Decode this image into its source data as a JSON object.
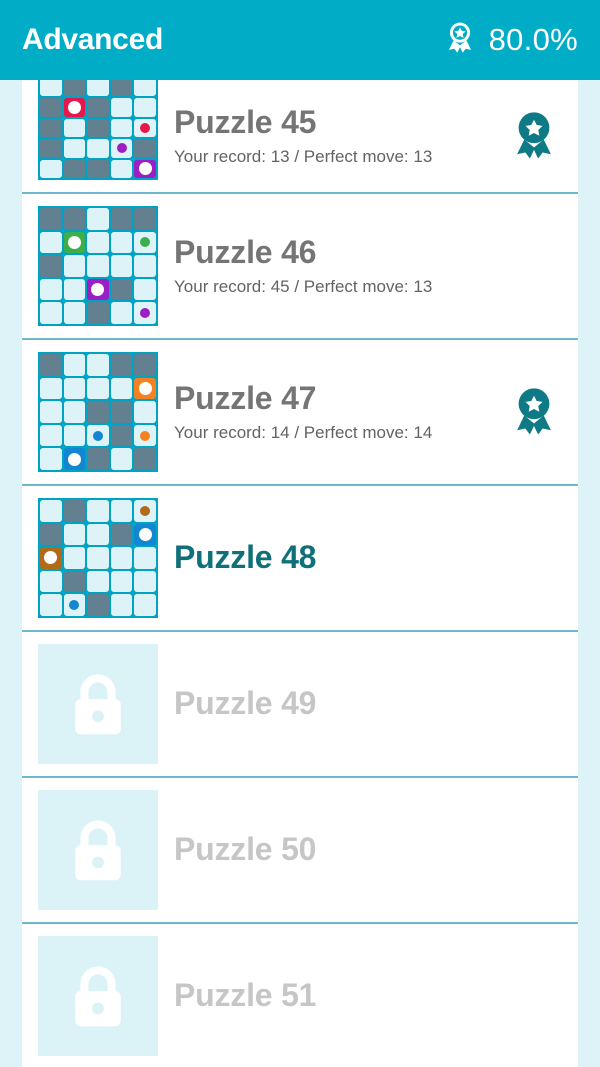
{
  "header": {
    "title": "Advanced",
    "percent": "80.0%",
    "medal_icon": "medal-ribbon-icon",
    "bg_color": "#00ACC6"
  },
  "theme": {
    "page_bg": "#DEF3F7",
    "card_bg": "#FFFFFF",
    "grid_line": "#00A3C4",
    "cell_light": "#DEF3F7",
    "cell_gray": "#62808F",
    "title_gray": "#757575",
    "title_current": "#10707A",
    "title_locked": "#C6C6C6",
    "badge_teal": "#0E7A85",
    "lock_tile_bg": "#DBF2F7"
  },
  "rows": [
    {
      "title": "Puzzle 45",
      "subtitle": "Your record: 13 / Perfect move: 13",
      "state": "completed",
      "has_badge": true,
      "clipped_top": true,
      "grid": [
        [
          "l",
          "g",
          "l",
          "g",
          "l"
        ],
        [
          "g",
          "R",
          "g",
          "l",
          "l"
        ],
        [
          "g",
          "l",
          "g",
          "l",
          "l.r"
        ],
        [
          "g",
          "l",
          "l",
          "l.p",
          "g"
        ],
        [
          "l",
          "g",
          "g",
          "l",
          "P"
        ]
      ]
    },
    {
      "title": "Puzzle 46",
      "subtitle": "Your record: 45 / Perfect move: 13",
      "state": "completed",
      "has_badge": false,
      "clipped_top": false,
      "grid": [
        [
          "g",
          "g",
          "l",
          "g",
          "g"
        ],
        [
          "l",
          "G",
          "l",
          "l",
          "l.n"
        ],
        [
          "g",
          "l",
          "l",
          "l",
          "l"
        ],
        [
          "l",
          "l",
          "P",
          "g",
          "l"
        ],
        [
          "l",
          "l",
          "g",
          "l",
          "l.p"
        ]
      ]
    },
    {
      "title": "Puzzle 47",
      "subtitle": "Your record: 14 / Perfect move: 14",
      "state": "completed",
      "has_badge": true,
      "clipped_top": false,
      "grid": [
        [
          "g",
          "l",
          "l",
          "g",
          "g"
        ],
        [
          "l",
          "l",
          "l",
          "l",
          "O"
        ],
        [
          "l",
          "l",
          "g",
          "g",
          "l"
        ],
        [
          "l",
          "l",
          "l.b",
          "g",
          "l.o"
        ],
        [
          "l",
          "B",
          "g",
          "l",
          "g"
        ]
      ]
    },
    {
      "title": "Puzzle 48",
      "subtitle": "",
      "state": "current",
      "has_badge": false,
      "clipped_top": false,
      "grid": [
        [
          "l",
          "g",
          "l",
          "l",
          "l.w"
        ],
        [
          "g",
          "l",
          "l",
          "g",
          "B"
        ],
        [
          "W",
          "l",
          "l",
          "l",
          "l"
        ],
        [
          "l",
          "g",
          "l",
          "l",
          "l"
        ],
        [
          "l",
          "l.b",
          "g",
          "l",
          "l"
        ]
      ]
    },
    {
      "title": "Puzzle 49",
      "subtitle": "",
      "state": "locked",
      "has_badge": false,
      "lock_icon": "lock-icon"
    },
    {
      "title": "Puzzle 50",
      "subtitle": "",
      "state": "locked",
      "has_badge": false,
      "lock_icon": "lock-icon"
    },
    {
      "title": "Puzzle 51",
      "subtitle": "",
      "state": "locked",
      "has_badge": false,
      "lock_icon": "lock-icon"
    }
  ],
  "cell_colors": {
    "R": "#E8174B",
    "P": "#9B1FC4",
    "G": "#3DAE4A",
    "O": "#F58220",
    "B": "#1286D0",
    "W": "#B06A18",
    "r": "#E8174B",
    "p": "#9B1FC4",
    "n": "#3DAE4A",
    "o": "#F58220",
    "b": "#1286D0",
    "w": "#B06A18"
  }
}
